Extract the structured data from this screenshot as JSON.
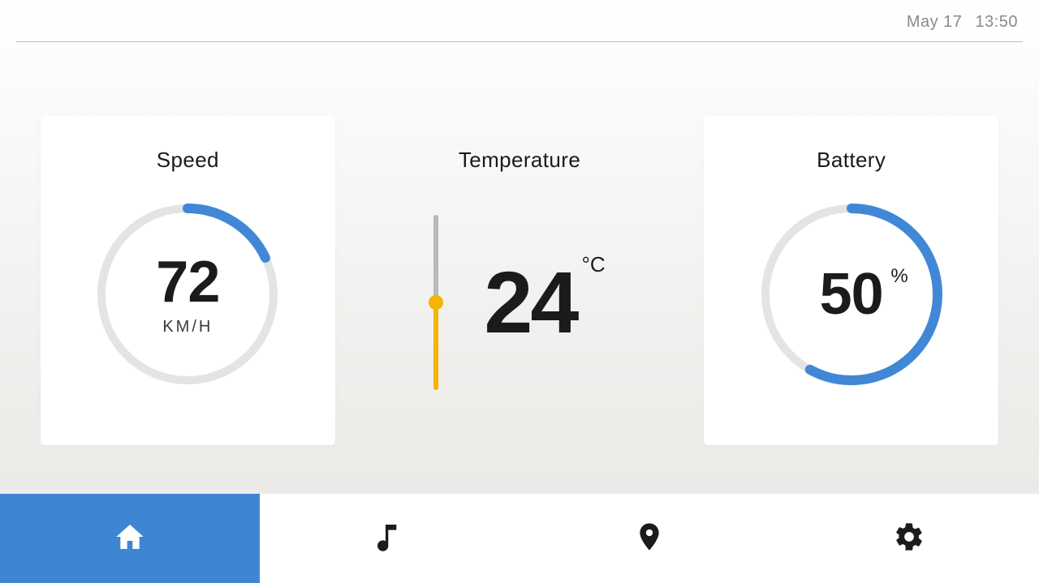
{
  "header": {
    "date": "May 17",
    "time": "13:50"
  },
  "speed": {
    "title": "Speed",
    "value": "72",
    "unit": "KM/H",
    "percent": 18
  },
  "temp": {
    "title": "Temperature",
    "value": "24",
    "unit": "°C"
  },
  "battery": {
    "title": "Battery",
    "value": "50",
    "unit": "%",
    "percent": 58
  },
  "nav": {
    "active": 0
  }
}
